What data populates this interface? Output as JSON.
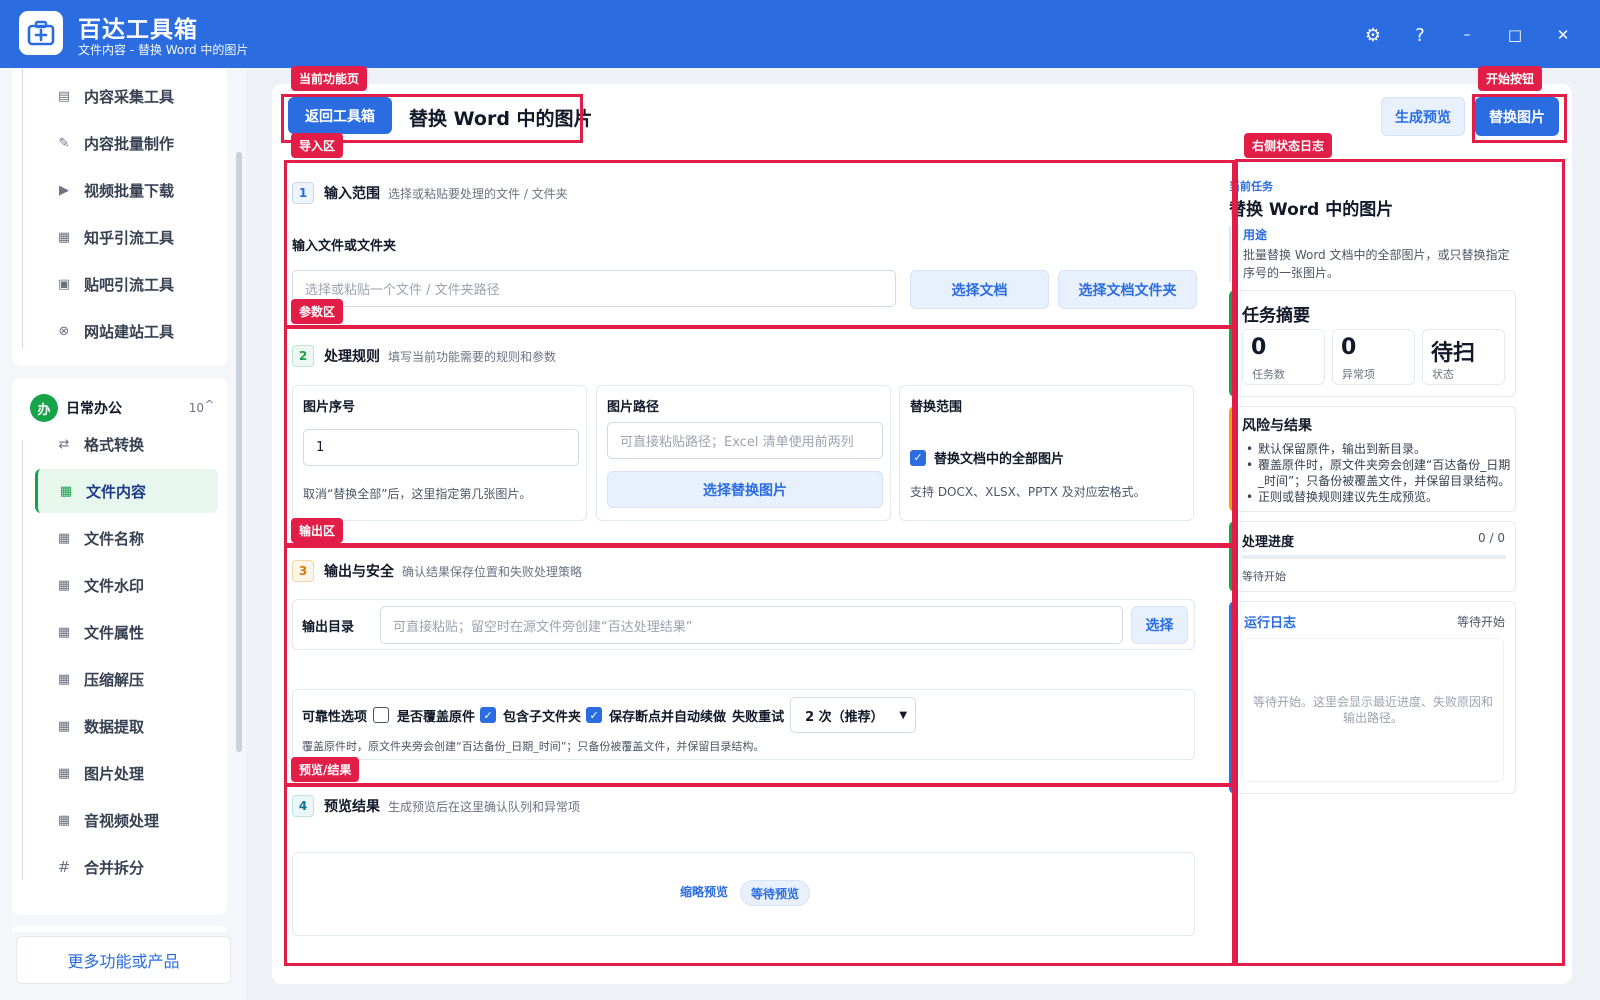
{
  "app": {
    "name": "百达工具箱",
    "subtitle": "文件内容 - 替换 Word 中的图片"
  },
  "window_controls": {
    "settings": "⚙",
    "help": "?",
    "minimize": "–",
    "maximize": "□",
    "close": "✕"
  },
  "sidebar": {
    "top_items": [
      {
        "label": "内容采集工具",
        "icon": "clipboard-icon"
      },
      {
        "label": "内容批量制作",
        "icon": "pen-icon"
      },
      {
        "label": "视频批量下载",
        "icon": "video-icon"
      },
      {
        "label": "知乎引流工具",
        "icon": "zhihu-icon"
      },
      {
        "label": "贴吧引流工具",
        "icon": "tieba-icon"
      },
      {
        "label": "网站建站工具",
        "icon": "globe-icon"
      }
    ],
    "group": {
      "badge": "办",
      "name": "日常办公",
      "count": "10",
      "caret": "^"
    },
    "group_items": [
      {
        "label": "格式转换",
        "icon": "convert-icon"
      },
      {
        "label": "文件内容",
        "icon": "grid-icon",
        "active": true
      },
      {
        "label": "文件名称",
        "icon": "grid-icon"
      },
      {
        "label": "文件水印",
        "icon": "grid-icon"
      },
      {
        "label": "文件属性",
        "icon": "grid-icon"
      },
      {
        "label": "压缩解压",
        "icon": "grid-icon"
      },
      {
        "label": "数据提取",
        "icon": "grid-icon"
      },
      {
        "label": "图片处理",
        "icon": "grid-icon"
      },
      {
        "label": "音视频处理",
        "icon": "grid-icon"
      },
      {
        "label": "合并拆分",
        "icon": "hash-icon"
      }
    ],
    "more_label": "更多功能或产品"
  },
  "header": {
    "back_label": "返回工具箱",
    "title": "替换 Word 中的图片",
    "preview_label": "生成预览",
    "start_label": "替换图片"
  },
  "section1": {
    "num": "1",
    "name": "输入范围",
    "desc": "选择或粘贴要处理的文件 / 文件夹",
    "field_label": "输入文件或文件夹",
    "input_placeholder": "选择或粘贴一个文件 / 文件夹路径",
    "btn_doc": "选择文档",
    "btn_folder": "选择文档文件夹"
  },
  "section2": {
    "num": "2",
    "name": "处理规则",
    "desc": "填写当前功能需要的规则和参数",
    "card1": {
      "label": "图片序号",
      "value": "1",
      "hint": "取消“替换全部”后，这里指定第几张图片。"
    },
    "card2": {
      "label": "图片路径",
      "placeholder": "可直接粘贴路径；Excel 清单使用前两列",
      "button": "选择替换图片"
    },
    "card3": {
      "label": "替换范围",
      "checkbox": "替换文档中的全部图片",
      "checked": true,
      "hint": "支持 DOCX、XLSX、PPTX 及对应宏格式。"
    }
  },
  "section3": {
    "num": "3",
    "name": "输出与安全",
    "desc": "确认结果保存位置和失败处理策略",
    "out_label": "输出目录",
    "out_placeholder": "可直接粘贴；留空时在源文件旁创建“百达处理结果”",
    "out_button": "选择",
    "rel_label": "可靠性选项",
    "opt_overwrite": "是否覆盖原件",
    "opt_overwrite_checked": false,
    "opt_subfolder": "包含子文件夹",
    "opt_subfolder_checked": true,
    "opt_resume": "保存断点并自动续做",
    "opt_resume_checked": true,
    "retry_label": "失败重试",
    "retry_value": "2 次（推荐）",
    "note": "覆盖原件时，原文件夹旁会创建“百达备份_日期_时间”；只备份被覆盖文件，并保留目录结构。"
  },
  "section4": {
    "num": "4",
    "name": "预览结果",
    "desc": "生成预览后在这里确认队列和异常项",
    "thumb_label": "缩略预览",
    "status_pill": "等待预览"
  },
  "right_panel": {
    "current_label": "当前任务",
    "task_title": "替换 Word 中的图片",
    "purpose_label": "用途",
    "purpose_text": "批量替换 Word 文档中的全部图片，或只替换指定序号的一张图片。",
    "summary_title": "任务摘要",
    "stats": [
      {
        "value": "0",
        "label": "任务数"
      },
      {
        "value": "0",
        "label": "异常项"
      },
      {
        "value": "待扫",
        "label": "状态"
      }
    ],
    "risk_title": "风险与结果",
    "risk_items": [
      "默认保留原件，输出到新目录。",
      "覆盖原件时，原文件夹旁会创建“百达备份_日期_时间”；只备份被覆盖文件，并保留目录结构。",
      "正则或替换规则建议先生成预览。"
    ],
    "progress_title": "处理进度",
    "progress_count": "0 / 0",
    "progress_value": 0,
    "progress_status": "等待开始",
    "log_title": "运行日志",
    "log_status": "等待开始",
    "log_placeholder": "等待开始。这里会显示最近进度、失败原因和输出路径。"
  },
  "annotations": {
    "current_page": "当前功能页",
    "start_button": "开始按钮",
    "import_area": "导入区",
    "right_log": "右侧状态日志",
    "params_area": "参数区",
    "output_area": "输出区",
    "preview_area": "预览/结果"
  },
  "colors": {
    "brand": "#2b6de0",
    "annotation": "#e11d48",
    "active_green": "#16a34a"
  }
}
